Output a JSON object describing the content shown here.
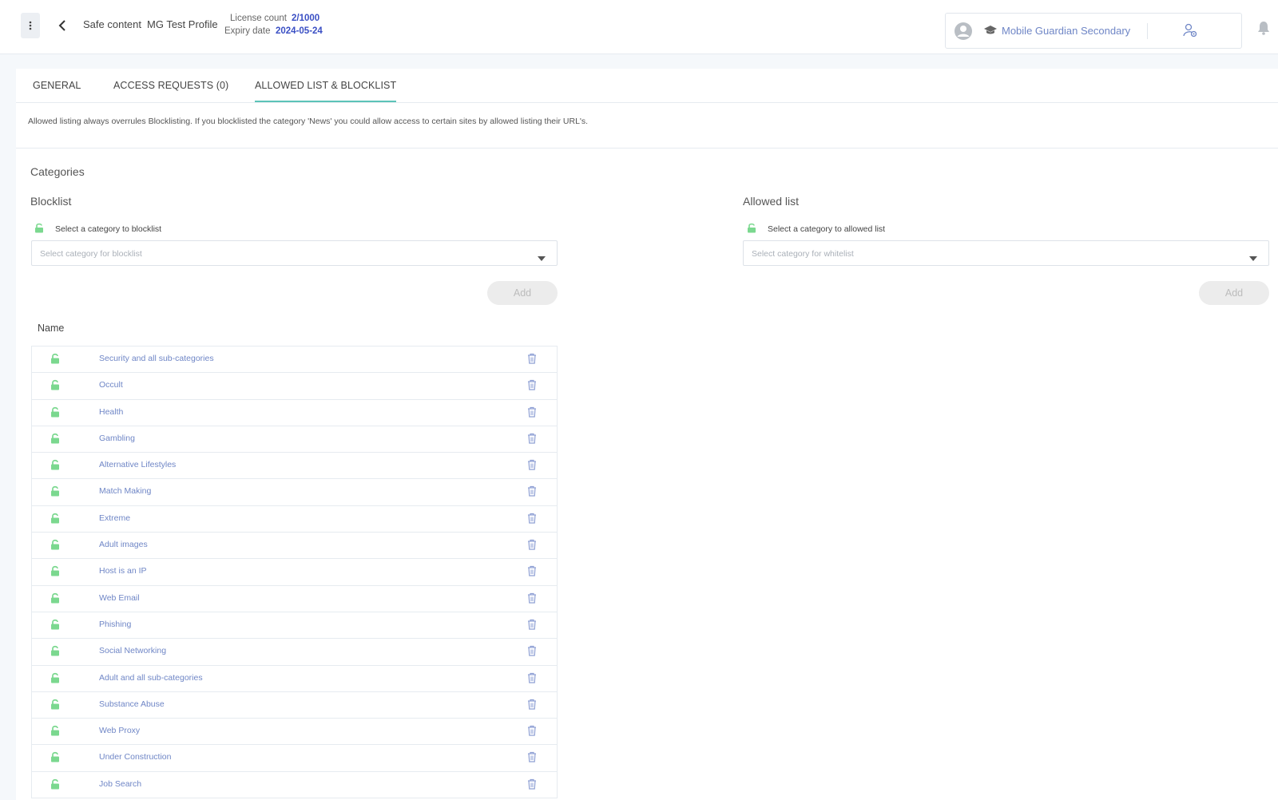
{
  "header": {
    "breadcrumb": [
      "Safe content",
      "MG Test Profile"
    ],
    "license_label": "License count",
    "license_value": "2/1000",
    "expiry_label": "Expiry date",
    "expiry_value": "2024-05-24",
    "school_name": "Mobile Guardian Secondary"
  },
  "tabs": [
    {
      "label": "GENERAL",
      "active": false
    },
    {
      "label": "ACCESS REQUESTS (0)",
      "active": false
    },
    {
      "label": "ALLOWED LIST & BLOCKLIST",
      "active": true
    }
  ],
  "info_text": "Allowed listing always overrules Blocklisting. If you blocklisted the category 'News' you could allow access to certain sites by allowed listing their URL's.",
  "categories_title": "Categories",
  "blocklist": {
    "title": "Blocklist",
    "select_label": "Select a category to blocklist",
    "placeholder": "Select category for blocklist",
    "add_label": "Add"
  },
  "allowed": {
    "title": "Allowed list",
    "select_label": "Select a category to allowed list",
    "placeholder": "Select category for whitelist",
    "add_label": "Add"
  },
  "table": {
    "header": "Name",
    "rows": [
      "Security and all sub-categories",
      "Occult",
      "Health",
      "Gambling",
      "Alternative Lifestyles",
      "Match Making",
      "Extreme",
      "Adult images",
      "Host is an IP",
      "Web Email",
      "Phishing",
      "Social Networking",
      "Adult and all sub-categories",
      "Substance Abuse",
      "Web Proxy",
      "Under Construction",
      "Job Search"
    ]
  },
  "colors": {
    "accent_teal": "#5cc3b8",
    "link_blue": "#6f86c6",
    "value_blue": "#3a4fc4",
    "lock_green": "#7bd88f"
  },
  "icons": [
    "more-vertical-icon",
    "chevron-left-icon",
    "avatar-icon",
    "graduation-cap-icon",
    "user-settings-icon",
    "bell-icon",
    "unlock-icon",
    "chevron-down-icon",
    "trash-icon"
  ]
}
